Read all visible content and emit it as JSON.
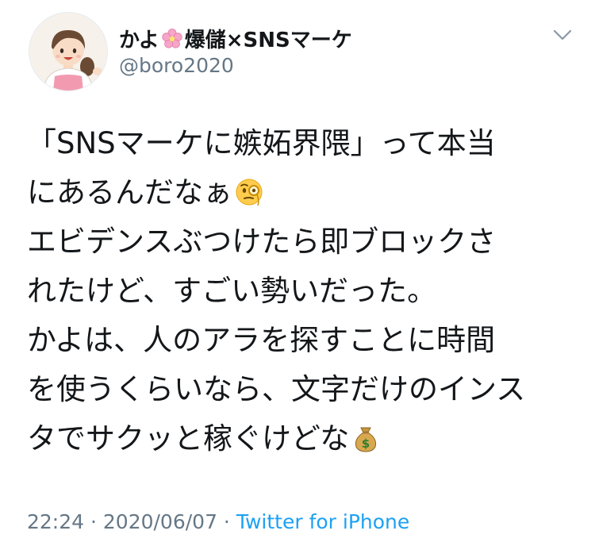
{
  "user": {
    "display_name_pre": "かよ",
    "display_name_post": "爆儲×SNSマーケ",
    "handle": "@boro2020"
  },
  "tweet": {
    "lines": [
      "「SNSマーケに嫉妬界隈」って本当",
      "にあるんだなぁ",
      "エビデンスぶつけたら即ブロックさ",
      "れたけど、すごい勢いだった。",
      "かよは、人のアラを探すことに時間",
      "を使うくらいなら、文字だけのインス",
      "タでサクッと稼ぐけどな"
    ],
    "line2_emoji": "monocle-face-emoji",
    "line7_emoji": "money-bag-emoji"
  },
  "meta": {
    "time": "22:24",
    "sep1": " · ",
    "date": "2020/06/07",
    "sep2": " · ",
    "source": "Twitter for iPhone"
  },
  "colors": {
    "text": "#14171a",
    "secondary": "#657786",
    "link": "#1da1f2"
  }
}
